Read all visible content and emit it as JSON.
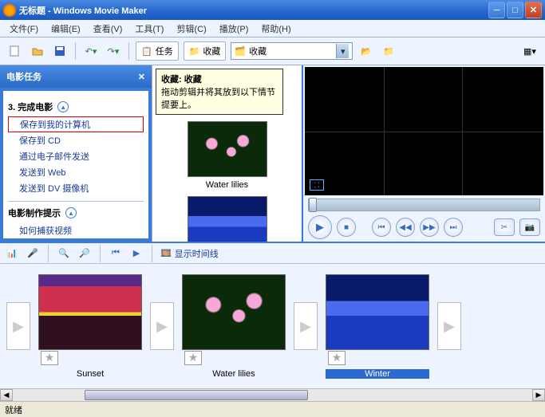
{
  "title": "无标题 - Windows Movie Maker",
  "menu": {
    "file": "文件(F)",
    "edit": "编辑(E)",
    "view": "查看(V)",
    "tools": "工具(T)",
    "clip": "剪辑(C)",
    "play": "播放(P)",
    "help": "帮助(H)"
  },
  "toolbar": {
    "tasks_label": "任务",
    "collections_label": "收藏",
    "dropdown_value": "收藏"
  },
  "tooltip": {
    "title": "收藏: 收藏",
    "body": "拖动剪辑并将其放到以下情节提要上。"
  },
  "taskpane": {
    "header": "电影任务",
    "step3": "3. 完成电影",
    "links": {
      "save_computer": "保存到我的计算机",
      "save_cd": "保存到 CD",
      "send_email": "通过电子邮件发送",
      "send_web": "发送到 Web",
      "send_dv": "发送到 DV 摄像机"
    },
    "tips_header": "电影制作提示",
    "tip1": "如何捕获视频"
  },
  "collection": {
    "item1_label": "Water lilies"
  },
  "timeline": {
    "show_timeline": "显示时间线",
    "clip1": "Sunset",
    "clip2": "Water lilies",
    "clip3": "Winter"
  },
  "status": "就绪"
}
